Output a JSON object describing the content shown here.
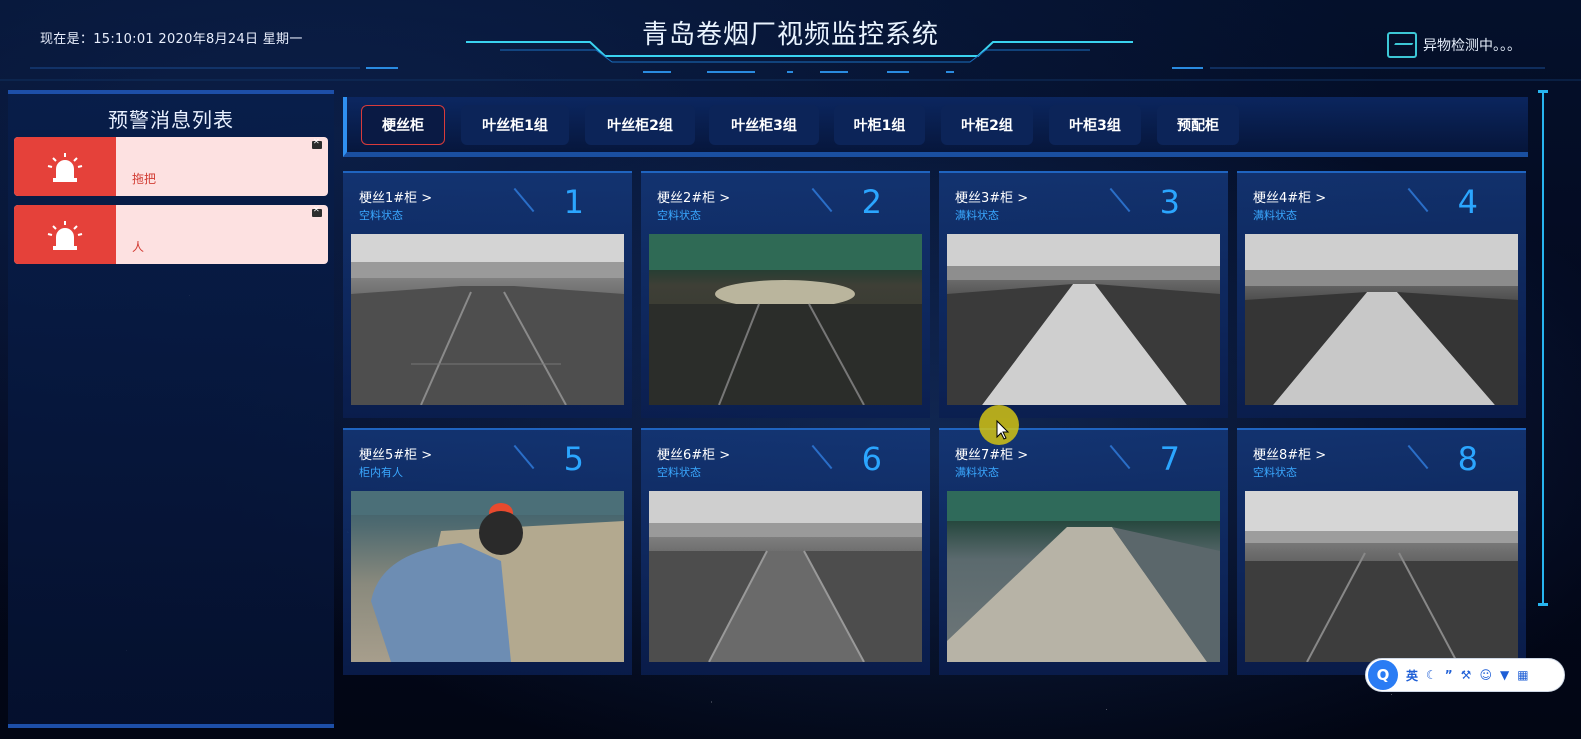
{
  "header": {
    "datetime": "现在是：15:10:01 2020年8月24日 星期一",
    "title": "青岛卷烟厂视频监控系统",
    "detect_label": "异物检测中。。。"
  },
  "sidebar": {
    "title": "预警消息列表",
    "alerts": [
      {
        "text": "拖把",
        "icon": "alarm-light-icon"
      },
      {
        "text": "人",
        "icon": "alarm-light-icon"
      }
    ]
  },
  "tabs": [
    {
      "label": "梗丝柜",
      "active": true
    },
    {
      "label": "叶丝柜1组"
    },
    {
      "label": "叶丝柜2组"
    },
    {
      "label": "叶丝柜3组"
    },
    {
      "label": "叶柜1组"
    },
    {
      "label": "叶柜2组"
    },
    {
      "label": "叶柜3组"
    },
    {
      "label": "预配柜"
    }
  ],
  "cameras": [
    {
      "name": "梗丝1#柜 >",
      "status": "空料状态",
      "num": "1"
    },
    {
      "name": "梗丝2#柜 >",
      "status": "空料状态",
      "num": "2"
    },
    {
      "name": "梗丝3#柜 >",
      "status": "满料状态",
      "num": "3"
    },
    {
      "name": "梗丝4#柜 >",
      "status": "满料状态",
      "num": "4"
    },
    {
      "name": "梗丝5#柜 >",
      "status": "柜内有人",
      "num": "5"
    },
    {
      "name": "梗丝6#柜 >",
      "status": "空料状态",
      "num": "6"
    },
    {
      "name": "梗丝7#柜 >",
      "status": "满料状态",
      "num": "7"
    },
    {
      "name": "梗丝8#柜 >",
      "status": "空料状态",
      "num": "8"
    }
  ],
  "ime": {
    "logo": "Q",
    "lang": "英",
    "icons": [
      "moon-icon",
      "quote-icon",
      "wrench-icon",
      "smile-icon",
      "shirt-icon",
      "grid-icon"
    ]
  },
  "colors": {
    "accent": "#2ba6ff",
    "alert_red": "#e5413a",
    "alert_bg": "#fde1e1",
    "active_tab_border": "#d83b3b"
  }
}
